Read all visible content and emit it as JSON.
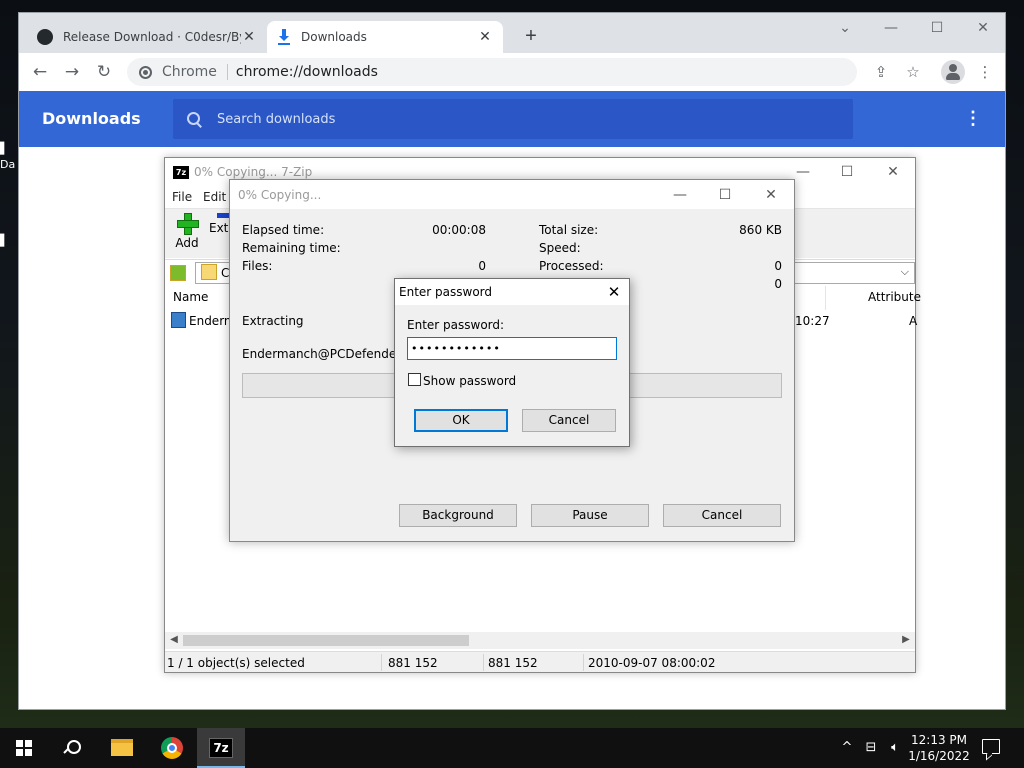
{
  "desktop": {
    "icon_label_fragment": "Da"
  },
  "chrome": {
    "tabs": [
      {
        "title": "Release Download · C0desr/Bypa",
        "icon": "github-icon"
      },
      {
        "title": "Downloads",
        "icon": "download-icon"
      }
    ],
    "omnibox": {
      "site": "Chrome",
      "url": "chrome://downloads"
    },
    "downloads_page": {
      "title": "Downloads",
      "search_placeholder": "Search downloads"
    },
    "colors": {
      "header": "#3367d6",
      "search_bg": "#2a56c6"
    }
  },
  "sevenzip": {
    "title": "0% Copying... 7-Zip",
    "menu": [
      "File",
      "Edit"
    ],
    "toolbar": {
      "add_label": "Add",
      "extract_label": "Extr"
    },
    "address_fragment": "C",
    "columns": {
      "name": "Name",
      "attributes": "Attribute"
    },
    "row": {
      "name_fragment": "Enderm",
      "time_fragment": "10:27",
      "attr_fragment": "A"
    },
    "status": {
      "selection": "1 / 1 object(s) selected",
      "size": "881 152",
      "packed": "881 152",
      "modified": "2010-09-07 08:00:02"
    }
  },
  "copying": {
    "title": "0% Copying...",
    "elapsed_label": "Elapsed time:",
    "elapsed_value": "00:00:08",
    "remaining_label": "Remaining time:",
    "files_label": "Files:",
    "files_value": "0",
    "total_label": "Total size:",
    "total_value": "860 KB",
    "speed_label": "Speed:",
    "processed_label": "Processed:",
    "processed_value": "0",
    "fourth_value": "0",
    "action": "Extracting",
    "filename": "Endermanch@PCDefenderv2.m",
    "progress": 0,
    "buttons": {
      "background": "Background",
      "pause": "Pause",
      "cancel": "Cancel"
    }
  },
  "password_dialog": {
    "title": "Enter password",
    "label": "Enter password:",
    "value": "••••••••••••",
    "show_password_label": "Show password",
    "show_password_checked": false,
    "ok": "OK",
    "cancel": "Cancel"
  },
  "taskbar": {
    "time": "12:13 PM",
    "date": "1/16/2022",
    "apps": [
      "file-explorer",
      "chrome",
      "7-zip"
    ],
    "sevenzip_icon_text": "7z"
  }
}
